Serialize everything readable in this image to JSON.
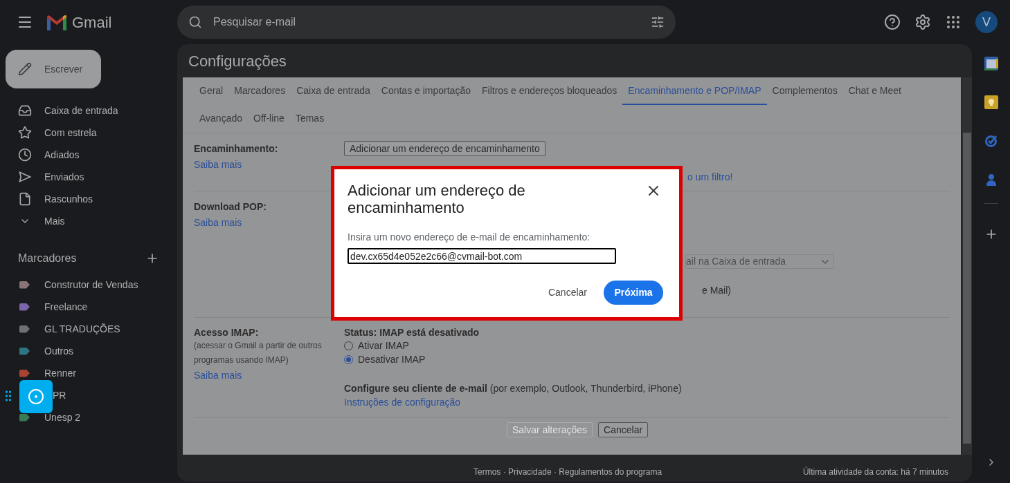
{
  "app": {
    "name": "Gmail"
  },
  "search": {
    "placeholder": "Pesquisar e-mail"
  },
  "account": {
    "initial": "V"
  },
  "compose": {
    "label": "Escrever"
  },
  "nav": [
    {
      "kind": "inbox",
      "label": "Caixa de entrada"
    },
    {
      "kind": "star",
      "label": "Com estrela"
    },
    {
      "kind": "clock",
      "label": "Adiados"
    },
    {
      "kind": "send",
      "label": "Enviados"
    },
    {
      "kind": "file",
      "label": "Rascunhos"
    },
    {
      "kind": "more",
      "label": "Mais"
    }
  ],
  "labels_header": "Marcadores",
  "labels": [
    {
      "label": "Construtor de Vendas",
      "color": "#8a7475",
      "kind": "tag"
    },
    {
      "label": "Freelance",
      "color": "#7a66a8",
      "kind": "tag"
    },
    {
      "label": "GL TRADUÇÕES",
      "color": "#6f7072",
      "kind": "tag"
    },
    {
      "label": "Outros",
      "color": "#2e7584",
      "kind": "tag"
    },
    {
      "label": "Renner",
      "color": "#a84334",
      "kind": "tag"
    },
    {
      "label": "PR",
      "kind": "covered"
    },
    {
      "label": "Unesp 2",
      "color": "#3a7b57",
      "kind": "tag"
    }
  ],
  "settings": {
    "title": "Configurações",
    "tabs": [
      {
        "label": "Geral",
        "selected": false
      },
      {
        "label": "Marcadores",
        "selected": false
      },
      {
        "label": "Caixa de entrada",
        "selected": false
      },
      {
        "label": "Contas e importação",
        "selected": false
      },
      {
        "label": "Filtros e endereços bloqueados",
        "selected": false
      },
      {
        "label": "Encaminhamento e POP/IMAP",
        "selected": true
      },
      {
        "label": "Complementos",
        "selected": false
      },
      {
        "label": "Chat e Meet",
        "selected": false
      },
      {
        "label": "Avançado",
        "selected": false
      },
      {
        "label": "Off-line",
        "selected": false
      },
      {
        "label": "Temas",
        "selected": false
      }
    ],
    "forwarding": {
      "heading": "Encaminhamento:",
      "link": "Saiba mais",
      "button": "Adicionar um endereço de encaminhamento",
      "partial_link": "o um filtro!"
    },
    "pop": {
      "heading": "Download POP:",
      "link": "Saiba mais",
      "partial_select": "ail na Caixa de entrada",
      "partial_text": "e Mail)"
    },
    "imap": {
      "heading": "Acesso IMAP:",
      "description": "(acessar o Gmail a partir de outros programas usando IMAP)",
      "link": "Saiba mais",
      "status": "Status: IMAP está desativado",
      "options": [
        {
          "label": "Ativar IMAP",
          "checked": false
        },
        {
          "label": "Desativar IMAP",
          "checked": true
        }
      ],
      "client": "**Configure seu cliente de e-mail** (por exemplo, Outlook, Thunderbird, iPhone)",
      "client_link": "Instruções de configuração"
    },
    "save": {
      "label": "Salvar alterações",
      "disabled": true
    },
    "cancel": "Cancelar",
    "footer": {
      "links": "Termos · Privacidade · Regulamentos do programa",
      "activity": "Última atividade da conta: há 7 minutos"
    }
  },
  "dialog": {
    "title": "Adicionar um endereço de encaminhamento",
    "label": "Insira um novo endereço de e-mail de encaminhamento:",
    "value": "dev.cx65d4e052e2c66@cvmail-bot.com",
    "cancel": "Cancelar",
    "next": "Próxima"
  }
}
